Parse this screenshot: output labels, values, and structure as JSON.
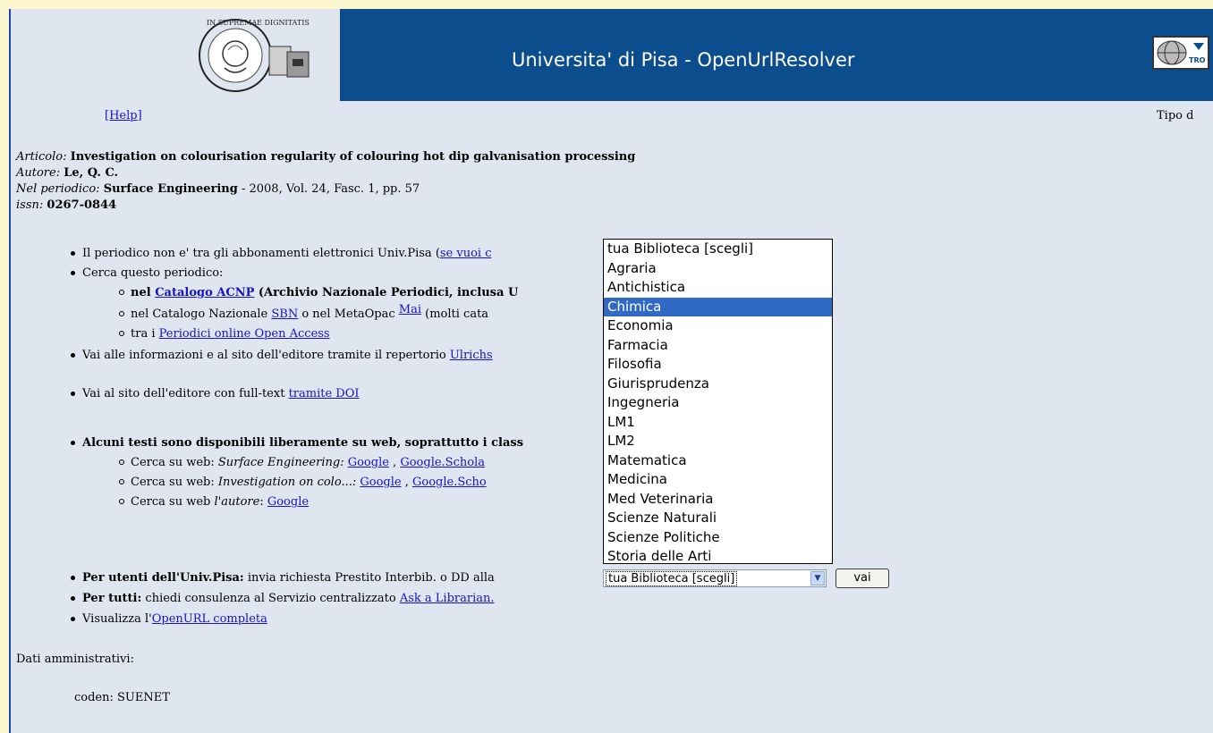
{
  "header": {
    "title": "Universita' di Pisa - OpenUrlResolver",
    "logo_text": "IN SUPREMAE DIGNITATIS",
    "partner_text": "TRO"
  },
  "help_link": "[Help]",
  "tipo_label": "Tipo d",
  "record": {
    "articolo_label": "Articolo:",
    "articolo": "Investigation on colourisation regularity of colouring hot dip galvanisation processing",
    "autore_label": "Autore:",
    "autore": "Le, Q. C.",
    "periodico_label": "Nel periodico:",
    "periodico": "Surface Engineering",
    "periodico_details": " - 2008, Vol. 24, Fasc. 1, pp. 57",
    "issn_label": "issn:",
    "issn": "0267-0844"
  },
  "items": {
    "abbonamenti_text": "Il periodico non e' tra gli abbonamenti elettronici Univ.Pisa (",
    "abbonamenti_link": "se vuoi c",
    "cerca_periodico": "Cerca questo periodico:",
    "acnp_prefix": "nel ",
    "acnp_link": "Catalogo ACNP",
    "acnp_suffix": " (Archivio Nazionale Periodici, inclusa U",
    "sbn_prefix": "nel Catalogo Nazionale ",
    "sbn_link": "SBN",
    "sbn_middle": " o nel MetaOpac ",
    "mai_link": "Mai",
    "sbn_suffix": " (molti cata",
    "oa_prefix": "tra i ",
    "oa_link": "Periodici online Open Access",
    "ulrichs_text": "Vai alle informazioni e al sito dell'editore tramite il repertorio ",
    "ulrichs_link": "Ulrichs",
    "doi_text": "Vai al sito dell'editore con full-text ",
    "doi_link": "tramite DOI",
    "liberi_text": "Alcuni testi sono disponibili liberamente su web, soprattutto i class",
    "web1_prefix": "Cerca su web: ",
    "web1_term": "Surface Engineering:",
    "web1_google": "Google",
    "web1_sep": " , ",
    "web1_scholar": "Google.Schola",
    "web2_prefix": "Cerca su web: ",
    "web2_term": "Investigation on colo...:",
    "web2_google": "Google",
    "web2_sep": " , ",
    "web2_scholar": "Google.Scho",
    "web3_prefix": "Cerca su web ",
    "web3_term": "l'autore",
    "web3_colon": ": ",
    "web3_google": "Google",
    "prestito_bold": "Per utenti dell'Univ.Pisa:",
    "prestito_text": " invia richiesta Prestito Interbib. o DD alla",
    "tutti_bold": "Per tutti:",
    "tutti_text": " chiedi consulenza al Servizio centralizzato ",
    "tutti_link": "Ask a Librarian.",
    "openurl_prefix": "Visualizza l'",
    "openurl_link": "OpenURL completa"
  },
  "library_select": {
    "selected_value": "tua Biblioteca [scegli]",
    "highlighted": "Chimica",
    "options": [
      "tua Biblioteca [scegli]",
      "Agraria",
      "Antichistica",
      "Chimica",
      "Economia",
      "Farmacia",
      "Filosofia",
      "Giurisprudenza",
      "Ingegneria",
      "LM1",
      "LM2",
      "Matematica",
      "Medicina",
      "Med Veterinaria",
      "Scienze Naturali",
      "Scienze Politiche",
      "Storia delle Arti"
    ]
  },
  "vai_button": "vai",
  "admin": {
    "label": "Dati amministrativi:",
    "coden": "coden: SUENET"
  }
}
